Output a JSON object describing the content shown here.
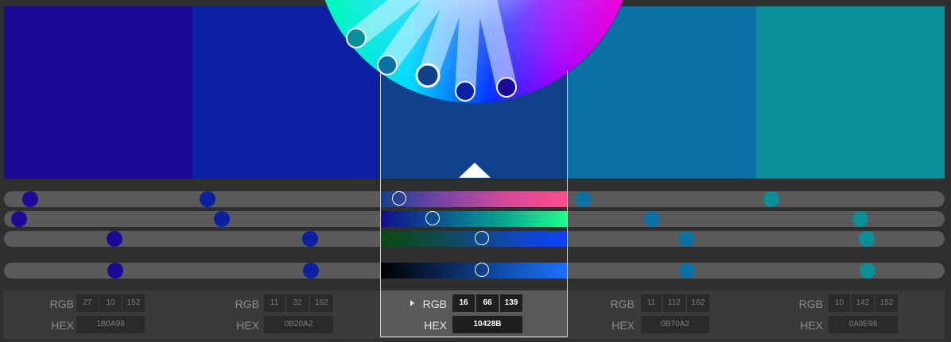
{
  "colors": {
    "background": "#2f2f2f",
    "track": "#5a5a5a",
    "panel": "#3a3a3a",
    "selected_panel": "#595959"
  },
  "swatches": [
    {
      "hex_color": "#1B0A98",
      "rgb": [
        "27",
        "10",
        "152"
      ],
      "hex": "1B0A98"
    },
    {
      "hex_color": "#0B20A2",
      "rgb": [
        "11",
        "32",
        "162"
      ],
      "hex": "0B20A2"
    },
    {
      "hex_color": "#10428B",
      "rgb": [
        "16",
        "66",
        "139"
      ],
      "hex": "10428B",
      "selected": true
    },
    {
      "hex_color": "#0B70A2",
      "rgb": [
        "11",
        "112",
        "162"
      ],
      "hex": "0B70A2"
    },
    {
      "hex_color": "#0A8E98",
      "rgb": [
        "10",
        "142",
        "152"
      ],
      "hex": "0A8E98"
    }
  ],
  "labels": {
    "rgb": "RGB",
    "hex": "HEX"
  },
  "selected_indicator": "caret-right-icon",
  "wheel": {
    "icon": "color-wheel",
    "handle_colors": [
      "#0A8E98",
      "#0B70A2",
      "#10428B",
      "#0B20A2",
      "#1B0A98"
    ]
  }
}
